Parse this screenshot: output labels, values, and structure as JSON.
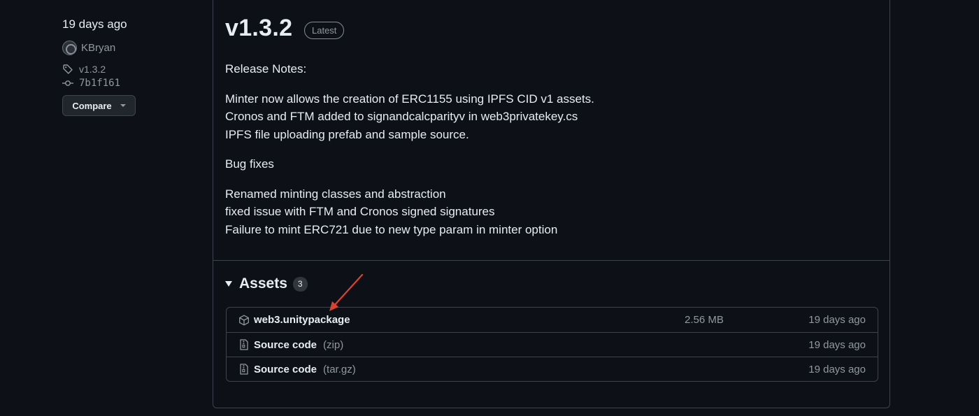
{
  "meta": {
    "date": "19 days ago",
    "author": "KBryan",
    "tag": "v1.3.2",
    "commit": "7b1f161",
    "compare_label": "Compare"
  },
  "release": {
    "version": "v1.3.2",
    "badge": "Latest",
    "notes": [
      [
        "Release Notes:"
      ],
      [
        "Minter now allows the creation of ERC1155 using IPFS CID v1 assets.",
        "Cronos and FTM added to signandcalcparityv in web3privatekey.cs",
        "IPFS file uploading prefab and sample source."
      ],
      [
        "Bug fixes"
      ],
      [
        "Renamed minting classes and abstraction",
        "fixed issue with FTM and Cronos signed signatures",
        "Failure to mint ERC721 due to new type param in minter option"
      ]
    ]
  },
  "assets": {
    "title": "Assets",
    "count": "3",
    "items": [
      {
        "icon": "package-icon",
        "name": "web3.unitypackage",
        "suffix": "",
        "size": "2.56 MB",
        "date": "19 days ago"
      },
      {
        "icon": "file-zip-icon",
        "name": "Source code",
        "suffix": "(zip)",
        "size": "",
        "date": "19 days ago"
      },
      {
        "icon": "file-zip-icon",
        "name": "Source code",
        "suffix": "(tar.gz)",
        "size": "",
        "date": "19 days ago"
      }
    ]
  },
  "colors": {
    "background": "#0d1117",
    "border": "#3d444d",
    "text": "#e6edf3",
    "muted": "#9198a1",
    "annotation_arrow": "#d9432f"
  }
}
